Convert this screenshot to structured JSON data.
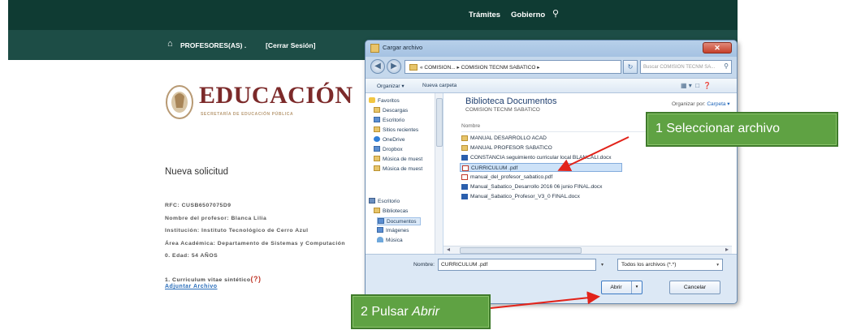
{
  "site": {
    "top_links": [
      "Trámites",
      "Gobierno"
    ],
    "nav": {
      "profesores": "PROFESORES(AS) .",
      "cerrar_sesion": "[Cerrar Sesión]"
    }
  },
  "logo": {
    "title": "EDUCACIÓN",
    "subtitle": "SECRETARÍA DE EDUCACIÓN PÚBLICA"
  },
  "form": {
    "heading": "Nueva solicitud",
    "info": [
      "RFC: CUSB6507075D9",
      "Nombre del profesor: Blanca Lilia",
      "Institución: Instituto Tecnológico de Cerro Azul",
      "Área Académica: Departamento de Sistemas y Computación",
      "0. Edad: 54 AÑOS"
    ],
    "cv_label": "1. Curriculum vitae sintético",
    "cv_help": "(?)",
    "attach_link": "Adjuntar Archivo"
  },
  "dialog": {
    "title": "Cargar archivo",
    "close": "✕",
    "address": "« COMISION... ▸ COMISION TECNM SABATICO ▸",
    "search_placeholder": "Buscar COMISION TECNM SA...",
    "toolbar": {
      "organizar": "Organizar ▾",
      "nueva_carpeta": "Nueva carpeta"
    },
    "nav_items": [
      {
        "label": "Favoritos",
        "icon": "star-icon"
      },
      {
        "label": "Descargas",
        "icon": "folder-icon"
      },
      {
        "label": "Escritorio",
        "icon": "desktop-icon"
      },
      {
        "label": "Sitios recientes",
        "icon": "folder-icon"
      },
      {
        "label": "OneDrive",
        "icon": "cloud-icon"
      },
      {
        "label": "Dropbox",
        "icon": "dropbox-icon"
      },
      {
        "label": "Música de muest",
        "icon": "folder-icon"
      },
      {
        "label": "Música de muest",
        "icon": "folder-icon"
      },
      {
        "label": "Escritorio",
        "icon": "desktop-icon"
      },
      {
        "label": "Bibliotecas",
        "icon": "library-icon"
      },
      {
        "label": "Documentos",
        "icon": "documents-icon"
      },
      {
        "label": "Imágenes",
        "icon": "pictures-icon"
      },
      {
        "label": "Música",
        "icon": "music-icon"
      }
    ],
    "library": {
      "title": "Biblioteca Documentos",
      "subtitle": "COMISION TECNM SABATICO",
      "organizar_por": "Organizar por:",
      "organizar_value": "Carpeta ▾"
    },
    "column": "Nombre",
    "files": [
      {
        "name": "MANUAL DESARROLLO ACAD",
        "type": "folder"
      },
      {
        "name": "MANUAL PROFESOR SABATICO",
        "type": "folder"
      },
      {
        "name": "CONSTANCIA  seguimiento curricular local BLANCALI.docx",
        "type": "docx"
      },
      {
        "name": "CURRICULUM .pdf",
        "type": "pdf",
        "selected": true
      },
      {
        "name": "manual_del_profesor_sabatico.pdf",
        "type": "pdf"
      },
      {
        "name": "Manual_Sabatico_Desarrollo 2016 06 junio FINAL.docx",
        "type": "docx"
      },
      {
        "name": "Manual_Sabatico_Profesor_V3_0 FINAL.docx",
        "type": "docx"
      }
    ],
    "filename_label": "Nombre:",
    "filename_value": "CURRICULUM .pdf",
    "filetype": "Todos los archivos (*.*)",
    "open_button": "Abrir",
    "cancel_button": "Cancelar"
  },
  "callouts": {
    "step1": "1 Seleccionar archivo",
    "step2_prefix": "2 Pulsar ",
    "step2_action": "Abrir"
  },
  "colors": {
    "callout_green": "#5fa243",
    "arrow_red": "#e2231a",
    "gov_dark": "#0f3b33",
    "logo_maroon": "#7c2a2a"
  }
}
